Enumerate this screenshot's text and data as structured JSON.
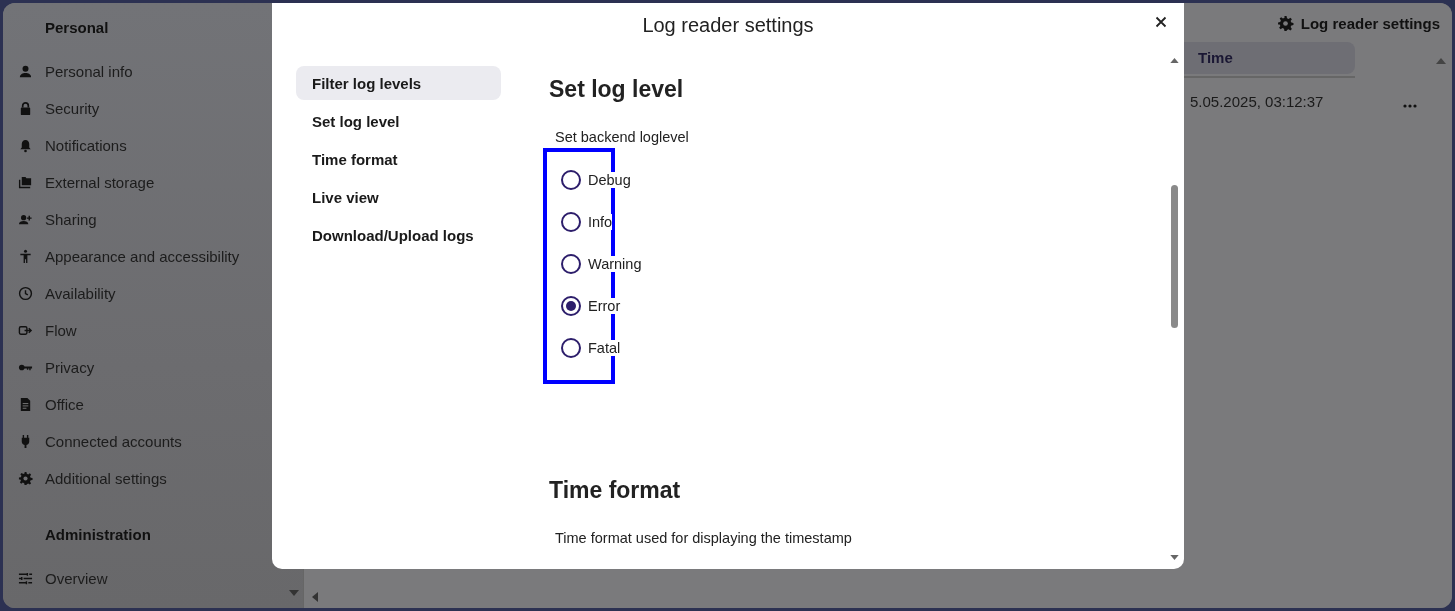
{
  "sidebar": {
    "sections": [
      {
        "title": "Personal",
        "items": [
          {
            "label": "Personal info"
          },
          {
            "label": "Security"
          },
          {
            "label": "Notifications"
          },
          {
            "label": "External storage"
          },
          {
            "label": "Sharing"
          },
          {
            "label": "Appearance and accessibility"
          },
          {
            "label": "Availability"
          },
          {
            "label": "Flow"
          },
          {
            "label": "Privacy"
          },
          {
            "label": "Office"
          },
          {
            "label": "Connected accounts"
          },
          {
            "label": "Additional settings"
          }
        ]
      },
      {
        "title": "Administration",
        "items": [
          {
            "label": "Overview"
          }
        ]
      }
    ]
  },
  "page": {
    "settings_button": "Log reader settings",
    "table": {
      "columns": [
        "Time"
      ],
      "rows": [
        {
          "time": "5.05.2025, 03:12:37"
        }
      ]
    }
  },
  "dialog": {
    "title": "Log reader settings",
    "nav": [
      {
        "label": "Filter log levels",
        "selected": true
      },
      {
        "label": "Set log level",
        "selected": false
      },
      {
        "label": "Time format",
        "selected": false
      },
      {
        "label": "Live view",
        "selected": false
      },
      {
        "label": "Download/Upload logs",
        "selected": false
      }
    ],
    "sections": [
      {
        "heading": "Set log level",
        "description": "Set backend loglevel",
        "options": [
          {
            "label": "Debug",
            "selected": false
          },
          {
            "label": "Info",
            "selected": false
          },
          {
            "label": "Warning",
            "selected": false
          },
          {
            "label": "Error",
            "selected": true
          },
          {
            "label": "Fatal",
            "selected": false
          }
        ]
      },
      {
        "heading": "Time format",
        "description": "Time format used for displaying the timestamp"
      }
    ]
  }
}
